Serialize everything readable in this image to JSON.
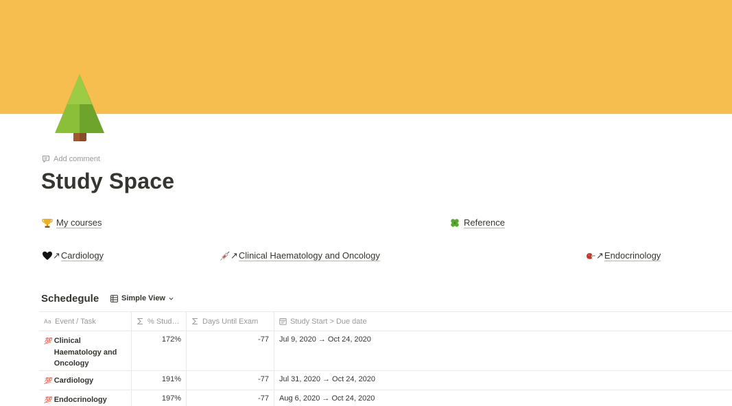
{
  "page": {
    "title": "Study Space",
    "add_comment": "Add comment",
    "cover_color": "#f6be4f",
    "icon": "evergreen-tree-icon"
  },
  "top_links": [
    {
      "icon": "trophy-icon",
      "label": "My courses"
    },
    {
      "icon": "four-leaf-clover-icon",
      "label": "Reference"
    }
  ],
  "course_links": [
    {
      "icon": "black-heart-icon",
      "arrow": "↗",
      "label": "Cardiology"
    },
    {
      "icon": "syringe-icon",
      "arrow": "↗",
      "label": "Clinical Haematology and Oncology"
    },
    {
      "icon": "kidney-icon",
      "arrow": "↗",
      "label": "Endocrinology"
    }
  ],
  "database": {
    "title": "Schedegule",
    "view": "Simple View",
    "columns": [
      "Event / Task",
      "% Stud…",
      "Days Until Exam",
      "Study Start > Due date"
    ],
    "rows": [
      {
        "badge": "💯",
        "name": "Clinical Haematology and Oncology",
        "percent": "172%",
        "days": "-77",
        "dates": "Jul 9, 2020 → Oct 24, 2020"
      },
      {
        "badge": "💯",
        "name": "Cardiology",
        "percent": "191%",
        "days": "-77",
        "dates": "Jul 31, 2020 → Oct 24, 2020"
      },
      {
        "badge": "💯",
        "name": "Endocrinology",
        "percent": "197%",
        "days": "-77",
        "dates": "Aug 6, 2020 → Oct 24, 2020"
      }
    ]
  }
}
